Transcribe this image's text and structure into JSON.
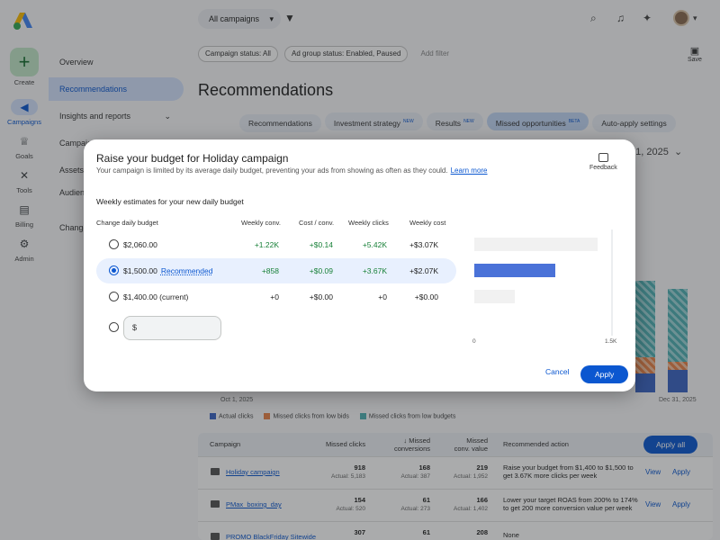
{
  "rail": {
    "create": "Create",
    "items": [
      {
        "label": "Campaigns",
        "icon": "megaphone-icon"
      },
      {
        "label": "Goals",
        "icon": "trophy-icon"
      },
      {
        "label": "Tools",
        "icon": "tools-icon"
      },
      {
        "label": "Billing",
        "icon": "card-icon"
      },
      {
        "label": "Admin",
        "icon": "gear-icon"
      }
    ]
  },
  "nav": {
    "items": [
      "Overview",
      "Recommendations",
      "Insights and reports",
      "Campaigns",
      "Assets",
      "Audiences, keywords, and content",
      "Change history"
    ]
  },
  "topbar": {
    "campaign_select": "All campaigns"
  },
  "filters": {
    "chips": [
      "Campaign status: All",
      "Ad group status: Enabled, Paused"
    ],
    "add_filter": "Add filter",
    "save": "Save"
  },
  "page_title": "Recommendations",
  "tabs": [
    {
      "label": "Recommendations",
      "badge": ""
    },
    {
      "label": "Investment strategy",
      "badge": "NEW"
    },
    {
      "label": "Results",
      "badge": "NEW"
    },
    {
      "label": "Missed opportunities",
      "badge": "BETA"
    },
    {
      "label": "Auto-apply settings",
      "badge": ""
    }
  ],
  "date_range": "31, 2025",
  "background_chart": {
    "x_start": "Oct 1, 2025",
    "x_end": "Dec 31, 2025",
    "legend": [
      "Actual clicks",
      "Missed clicks from low bids",
      "Missed clicks from low budgets"
    ],
    "colors": {
      "actual": "#3b64c4",
      "bids": "#e8834a",
      "budgets": "#4fb0b4"
    }
  },
  "table": {
    "headers": {
      "campaign": "Campaign",
      "missed_clicks": "Missed clicks",
      "missed_conversions": "Missed conversions",
      "missed_conv_value": "Missed conv. value",
      "recommended_action": "Recommended action"
    },
    "apply_all": "Apply all",
    "rows": [
      {
        "name": "Holiday campaign",
        "clicks": "918",
        "clicks_actual": "Actual: 5,183",
        "conv": "168",
        "conv_actual": "Actual: 387",
        "value": "219",
        "value_actual": "Actual: 1,952",
        "action": "Raise your budget from $1,400 to $1,500 to get 3.67K more clicks per week",
        "view": "View",
        "apply": "Apply"
      },
      {
        "name": "PMax_boxing_day",
        "clicks": "154",
        "clicks_actual": "Actual: 520",
        "conv": "61",
        "conv_actual": "Actual: 273",
        "value": "166",
        "value_actual": "Actual: 1,402",
        "action": "Lower your target ROAS from 200% to 174% to get 200 more conversion value per week",
        "view": "View",
        "apply": "Apply"
      },
      {
        "name": "PROMO BlackFriday Sitewide",
        "clicks": "307",
        "clicks_actual": "",
        "conv": "61",
        "conv_actual": "",
        "value": "208",
        "value_actual": "",
        "action": "None",
        "view": "",
        "apply": ""
      }
    ]
  },
  "dialog": {
    "title": "Raise your budget for Holiday campaign",
    "description": "Your campaign is limited by its average daily budget, preventing your ads from showing as often as they could.",
    "learn_more": "Learn more",
    "feedback": "Feedback",
    "subtitle": "Weekly estimates for your new daily budget",
    "columns": {
      "budget": "Change daily budget",
      "conv": "Weekly conv.",
      "cost_conv": "Cost / conv.",
      "clicks": "Weekly clicks",
      "cost": "Weekly cost"
    },
    "options": [
      {
        "budget": "$2,060.00",
        "tag": "",
        "conv": "+1.22K",
        "cost_conv": "+$0.14",
        "clicks": "+5.42K",
        "cost": "+$3.07K",
        "bar": 5.42
      },
      {
        "budget": "$1,500.00",
        "tag": "Recommended",
        "conv": "+858",
        "cost_conv": "+$0.09",
        "clicks": "+3.67K",
        "cost": "+$2.07K",
        "bar": 3.67
      },
      {
        "budget": "$1,400.00 (current)",
        "tag": "",
        "conv": "+0",
        "cost_conv": "+$0.00",
        "clicks": "+0",
        "cost": "+$0.00",
        "bar": 1.8
      }
    ],
    "custom_prefix": "$",
    "chart_axis": {
      "min": "0",
      "max": "1.5K"
    },
    "cancel": "Cancel",
    "apply": "Apply"
  }
}
